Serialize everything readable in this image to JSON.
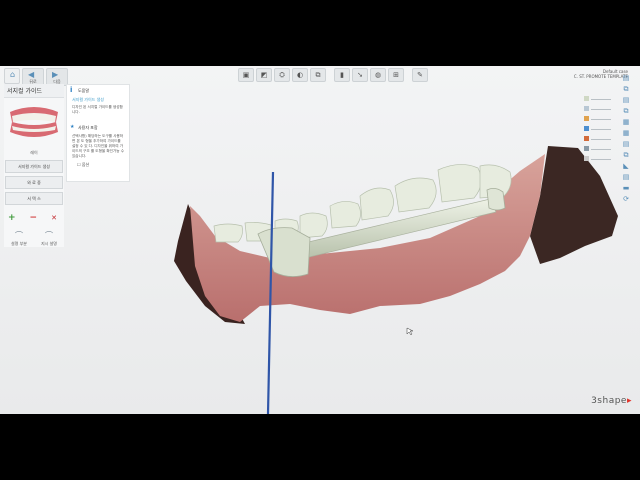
{
  "nav": {
    "home_label": "",
    "back_label": "뒤로",
    "next_label": "다음"
  },
  "workflow": {
    "title": "서지컬 가이드",
    "thumbnail_label": "레이",
    "create_button": "서지컬 가이드 생성",
    "finish_button": "와 료 중",
    "extra_button": "서 텍 스",
    "tools": {
      "add": "+",
      "remove": "−",
      "delete": "✕"
    },
    "tool2_left": "설명 부분",
    "tool2_right": "지시 설명"
  },
  "info": {
    "header": "도움말",
    "step_link": "서지컬 가이드 생성",
    "step_text": "디자인 된 서지컬 가이드를 생성합니다.",
    "section_title": "사용자 포함",
    "section_text": "선택사항) 해당하는 도구를 사용하면 본 도 형을 추가하여 가이드를 설정 수 있 다. 디자인을 위하여 가이드의 구조 를 도형을 확인가능 수 있습니다.",
    "check_label": "옵션"
  },
  "case": {
    "line1": "Default case",
    "line2": "C. ST. PROMOTE TEMPLATE"
  },
  "brand": {
    "name": "3shape",
    "accent": "#e2342b"
  },
  "colors": {
    "guide": "#cfd8c4",
    "gum": "#c98a88",
    "axis": "#2f55a8",
    "icon": "#5a8fb8"
  }
}
